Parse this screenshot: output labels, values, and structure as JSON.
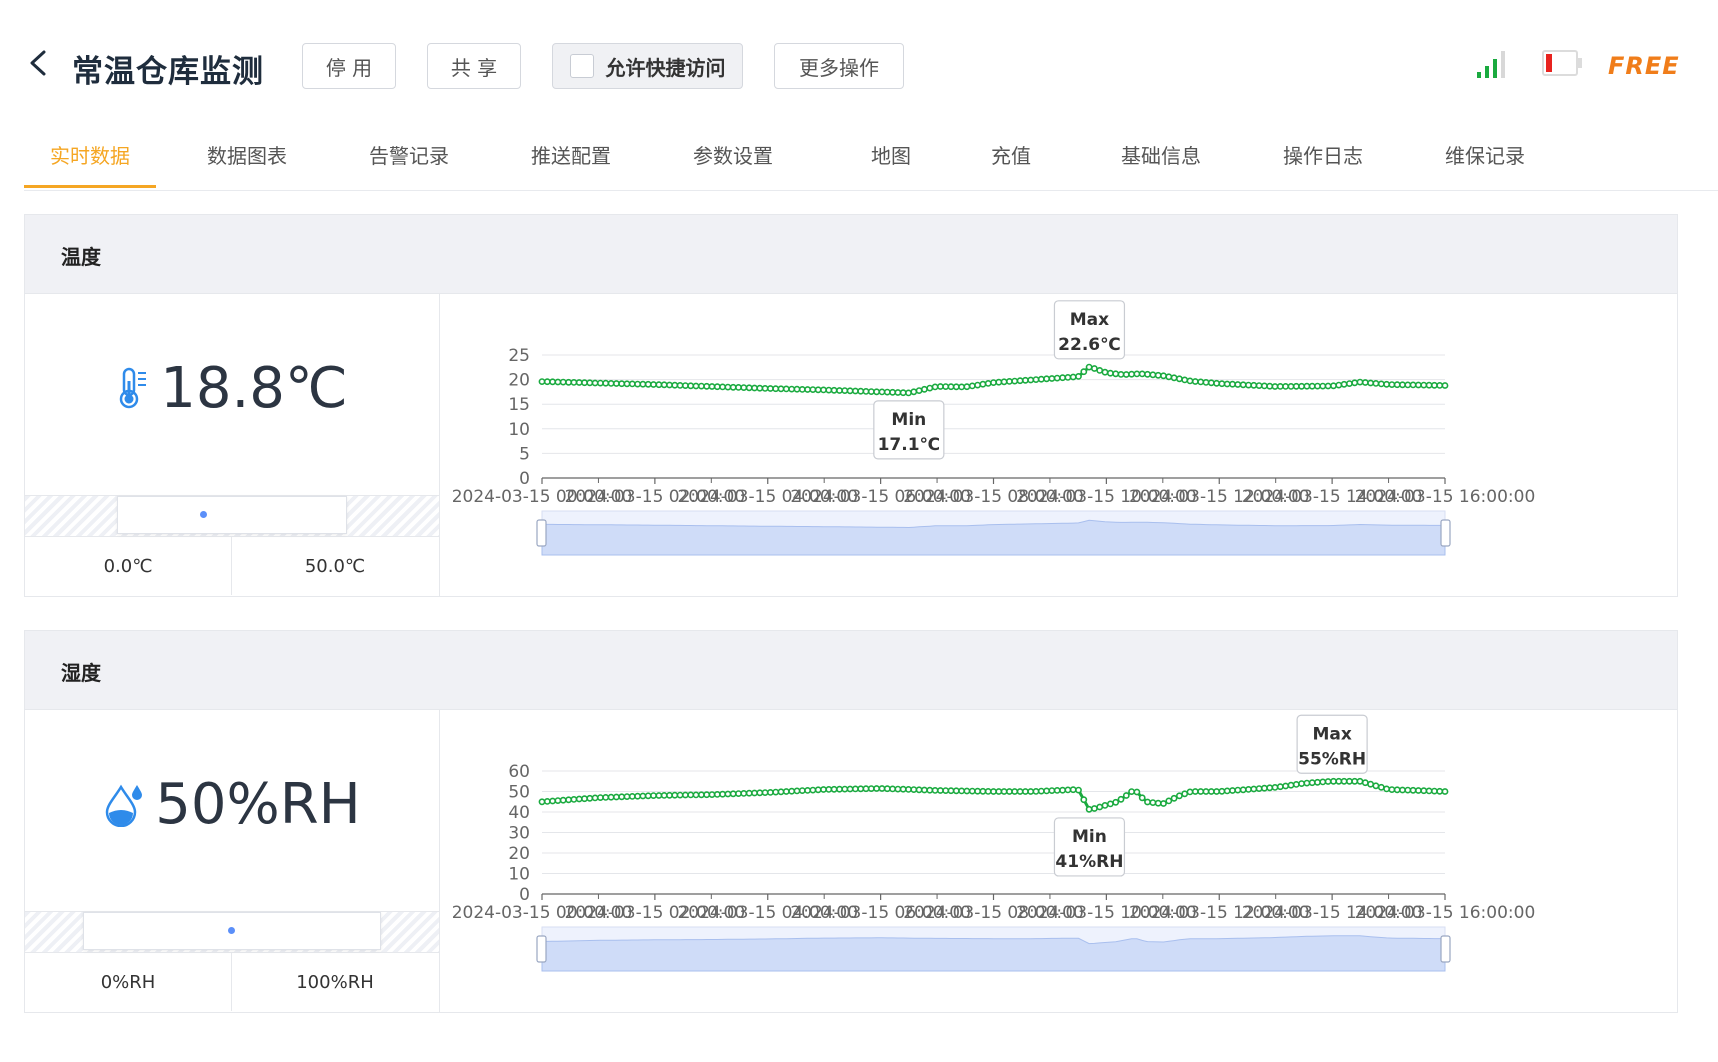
{
  "header": {
    "title": "常温仓库监测",
    "buttons": {
      "disable": "停 用",
      "share": "共 享",
      "quick_access": "允许快捷访问",
      "more": "更多操作"
    },
    "plan_label": "FREE"
  },
  "tabs": [
    "实时数据",
    "数据图表",
    "告警记录",
    "推送配置",
    "参数设置",
    "地图",
    "充值",
    "基础信息",
    "操作日志",
    "维保记录"
  ],
  "active_tab": 0,
  "icons": {
    "back": "chevron-left-icon",
    "signal": "signal-bars-icon",
    "battery": "battery-low-icon",
    "thermometer": "thermometer-icon",
    "droplet": "water-drop-icon"
  },
  "colors": {
    "accent": "#f5a623",
    "series": "#1aaa3f",
    "free": "#f07d1a",
    "value_icon": "#2f8bea"
  },
  "panels": {
    "temperature": {
      "title": "温度",
      "value": "18.8℃",
      "range_min": "0.0℃",
      "range_max": "50.0℃",
      "max_tip": {
        "label": "Max",
        "value": "22.6℃"
      },
      "min_tip": {
        "label": "Min",
        "value": "17.1℃"
      }
    },
    "humidity": {
      "title": "湿度",
      "value": "50%RH",
      "range_min": "0%RH",
      "range_max": "100%RH",
      "max_tip": {
        "label": "Max",
        "value": "55%RH"
      },
      "min_tip": {
        "label": "Min",
        "value": "41%RH"
      }
    }
  },
  "chart_data": [
    {
      "type": "line",
      "series_color": "#1aaa3f",
      "ylim": [
        0,
        25
      ],
      "yticks": [
        0,
        5,
        10,
        15,
        20,
        25
      ],
      "xlim": [
        "2024-03-15 00:00:00",
        "2024-03-15 16:00:00"
      ],
      "xtick_labels": [
        "2024-03-15 00:00:00",
        "2024-03-15 02:00:00",
        "2024-03-15 04:00:00",
        "2024-03-15 06:00:00",
        "2024-03-15 08:00:00",
        "2024-03-15 10:00:00",
        "2024-03-15 12:00:00",
        "2024-03-15 14:00:00",
        "2024-03-15 16:00:00"
      ],
      "x_hours": [
        0,
        1,
        2,
        3,
        4,
        5,
        6,
        6.5,
        7,
        7.5,
        8,
        8.5,
        9,
        9.5,
        9.7,
        10,
        10.3,
        10.6,
        11,
        11.5,
        12,
        13,
        14,
        14.5,
        15,
        16
      ],
      "values": [
        19.6,
        19.3,
        19.0,
        18.6,
        18.2,
        17.9,
        17.5,
        17.3,
        18.6,
        18.5,
        19.4,
        19.8,
        20.2,
        20.6,
        22.6,
        21.4,
        21.0,
        21.2,
        20.8,
        19.7,
        19.2,
        18.6,
        18.7,
        19.5,
        19.0,
        18.8
      ],
      "grid": true
    },
    {
      "type": "line",
      "series_color": "#1aaa3f",
      "ylim": [
        0,
        60
      ],
      "yticks": [
        0,
        10,
        20,
        30,
        40,
        50,
        60
      ],
      "xlim": [
        "2024-03-15 00:00:00",
        "2024-03-15 16:00:00"
      ],
      "xtick_labels": [
        "2024-03-15 00:00:00",
        "2024-03-15 02:00:00",
        "2024-03-15 04:00:00",
        "2024-03-15 06:00:00",
        "2024-03-15 08:00:00",
        "2024-03-15 10:00:00",
        "2024-03-15 12:00:00",
        "2024-03-15 14:00:00",
        "2024-03-15 16:00:00"
      ],
      "x_hours": [
        0,
        1,
        2,
        3,
        4,
        5,
        6,
        7,
        8,
        8.7,
        9.5,
        9.7,
        10.2,
        10.5,
        10.7,
        11,
        11.3,
        11.5,
        12,
        13,
        13.5,
        14,
        14.5,
        15,
        16
      ],
      "values": [
        45,
        47,
        48,
        48.5,
        49.5,
        51,
        51.5,
        50.5,
        50,
        50,
        51,
        41,
        45,
        51,
        45,
        44,
        48,
        50,
        50,
        52,
        54,
        55,
        55,
        51,
        50
      ],
      "grid": true
    }
  ]
}
